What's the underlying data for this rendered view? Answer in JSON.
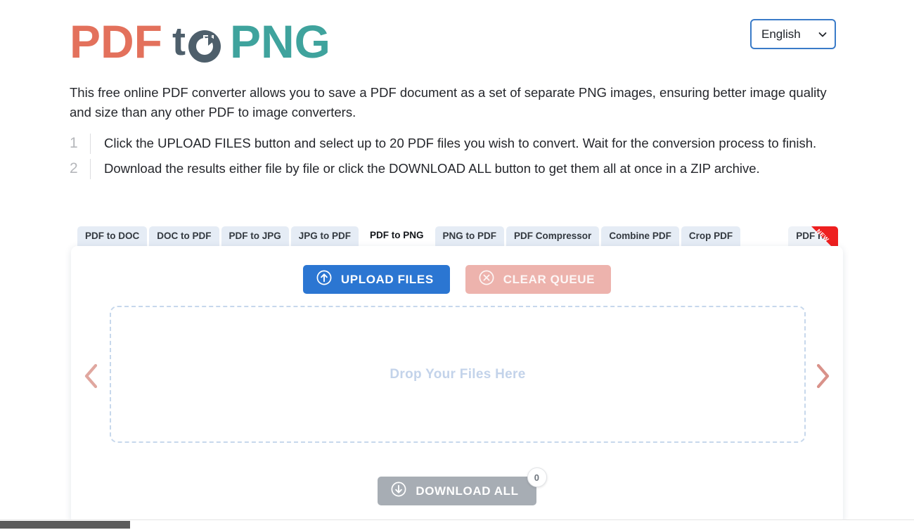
{
  "header": {
    "logo": {
      "part1": "PDF",
      "part2": "t",
      "icon": "circular-arrow-icon",
      "part3": "PNG"
    },
    "language": {
      "label": "English",
      "chevron": "chevron-down-icon"
    }
  },
  "intro": {
    "text": "This free online PDF converter allows you to save a PDF document as a set of separate PNG images, ensuring better image quality and size than any other PDF to image converters."
  },
  "steps": [
    {
      "num": "1",
      "text": "Click the UPLOAD FILES button and select up to 20 PDF files you wish to convert. Wait for the conversion process to finish."
    },
    {
      "num": "2",
      "text": "Download the results either file by file or click the DOWNLOAD ALL button to get them all at once in a ZIP archive."
    }
  ],
  "tabs": [
    {
      "label": "PDF to DOC",
      "active": false
    },
    {
      "label": "DOC to PDF",
      "active": false
    },
    {
      "label": "PDF to JPG",
      "active": false
    },
    {
      "label": "JPG to PDF",
      "active": false
    },
    {
      "label": "PDF to PNG",
      "active": true
    },
    {
      "label": "PNG to PDF",
      "active": false
    },
    {
      "label": "PDF Compressor",
      "active": false
    },
    {
      "label": "Combine PDF",
      "active": false
    },
    {
      "label": "Crop PDF",
      "active": false
    }
  ],
  "kit_tab": {
    "label": "PDF Kit",
    "badge": "NEW"
  },
  "card": {
    "upload_button": {
      "label": "UPLOAD FILES",
      "icon": "upload-arrow-circle-icon"
    },
    "clear_button": {
      "label": "CLEAR QUEUE",
      "icon": "close-circle-icon"
    },
    "dropzone": {
      "text": "Drop Your Files Here"
    },
    "prev_arrow": "chevron-left-icon",
    "next_arrow": "chevron-right-icon",
    "download_button": {
      "label": "DOWNLOAD ALL",
      "icon": "download-arrow-circle-icon",
      "count": "0"
    }
  },
  "colors": {
    "logo_red": "#e3715c",
    "logo_teal": "#3fa39d",
    "logo_slate": "#4e5f6b",
    "primary_blue": "#2b76d2",
    "clear_pink": "#edb3ad",
    "disabled_gray": "#a7adb4",
    "ribbon_red": "#ee1f1f",
    "tab_bg": "#e5ecf5"
  }
}
